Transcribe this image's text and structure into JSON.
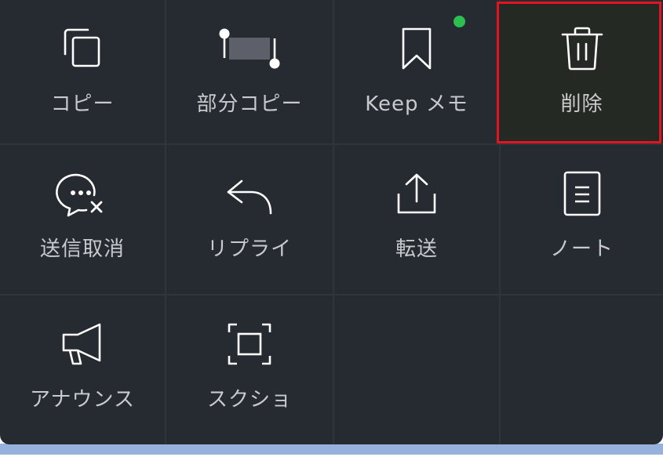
{
  "colors": {
    "panel_background": "#262a31",
    "label_text": "#c9cacd",
    "icon_stroke": "#ffffff",
    "highlight_border": "#e2141f",
    "new_dot": "#2bc050"
  },
  "menu": {
    "items": [
      {
        "label": "コピー",
        "icon": "copy-icon"
      },
      {
        "label": "部分コピー",
        "icon": "partial-copy-icon"
      },
      {
        "label": "Keep メモ",
        "icon": "bookmark-icon"
      },
      {
        "label": "削除",
        "icon": "trash-icon",
        "highlighted": true
      },
      {
        "label": "送信取消",
        "icon": "unsend-icon"
      },
      {
        "label": "リプライ",
        "icon": "reply-icon"
      },
      {
        "label": "転送",
        "icon": "share-icon"
      },
      {
        "label": "ノート",
        "icon": "note-icon"
      },
      {
        "label": "アナウンス",
        "icon": "megaphone-icon"
      },
      {
        "label": "スクショ",
        "icon": "screenshot-icon"
      }
    ]
  }
}
